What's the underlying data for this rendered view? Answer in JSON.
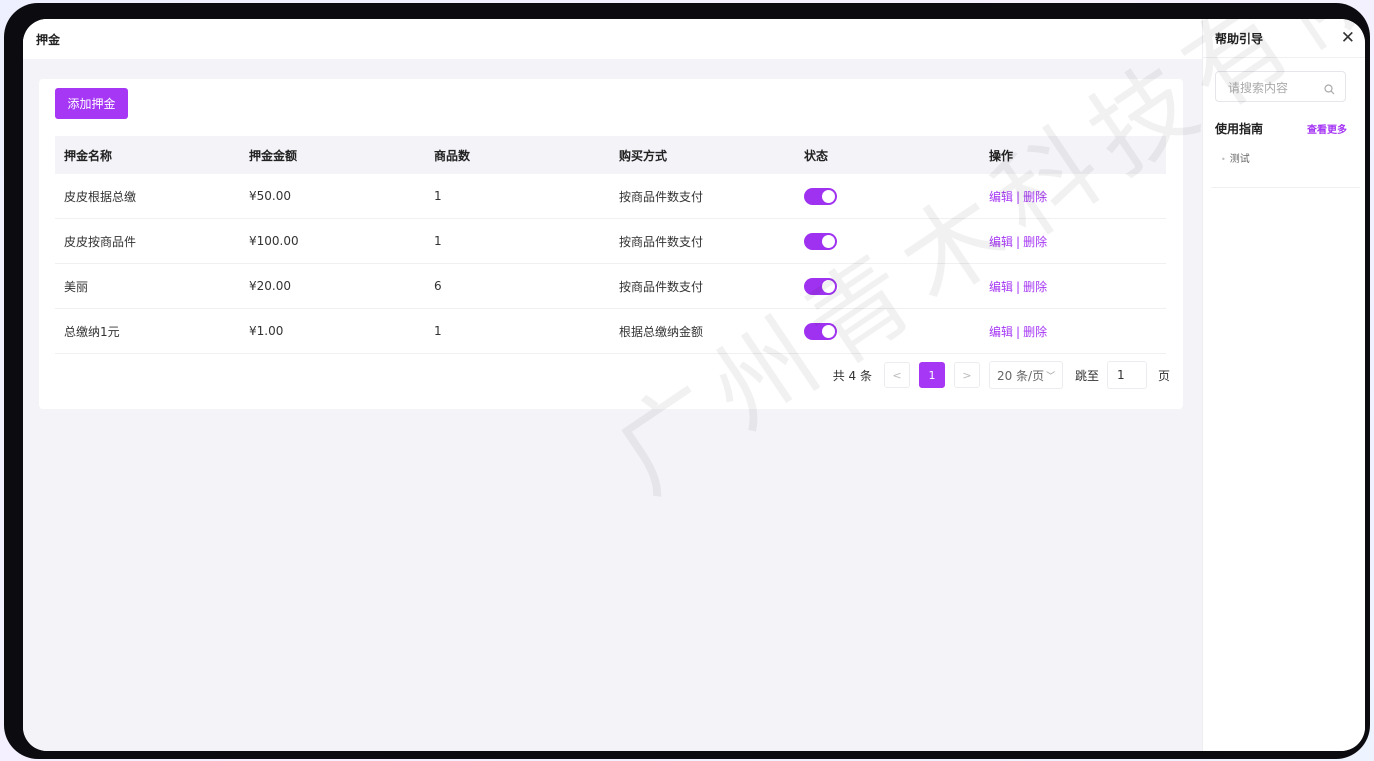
{
  "topbar": {
    "title": "押金"
  },
  "toolbar": {
    "add_label": "添加押金"
  },
  "table": {
    "headers": [
      "押金名称",
      "押金金额",
      "商品数",
      "购买方式",
      "状态",
      "操作"
    ],
    "rows": [
      {
        "name": "皮皮根据总缴",
        "amount": "¥50.00",
        "count": "1",
        "method": "按商品件数支付",
        "enabled": true
      },
      {
        "name": "皮皮按商品件",
        "amount": "¥100.00",
        "count": "1",
        "method": "按商品件数支付",
        "enabled": true
      },
      {
        "name": "美丽",
        "amount": "¥20.00",
        "count": "6",
        "method": "按商品件数支付",
        "enabled": true
      },
      {
        "name": "总缴纳1元",
        "amount": "¥1.00",
        "count": "1",
        "method": "根据总缴纳金额",
        "enabled": true
      }
    ],
    "actions": {
      "edit": "编辑",
      "separator": "|",
      "delete": "删除"
    }
  },
  "pagination": {
    "total_text": "共 4 条",
    "prev": "<",
    "current": "1",
    "next": ">",
    "page_size": "20 条/页",
    "jump_label": "跳至",
    "jump_value": "1",
    "page_suffix": "页"
  },
  "help": {
    "title": "帮助引导",
    "close": "✕",
    "search_placeholder": "请搜索内容",
    "guide_title": "使用指南",
    "more": "查看更多",
    "items": [
      "测试"
    ]
  },
  "watermark": "广州青木科技有限公",
  "colors": {
    "accent": "#a637f4",
    "toggle_on": "#9f32f0"
  },
  "icons": {
    "search": "search-icon",
    "close": "close-icon",
    "chevron": "chevron-down-icon"
  }
}
